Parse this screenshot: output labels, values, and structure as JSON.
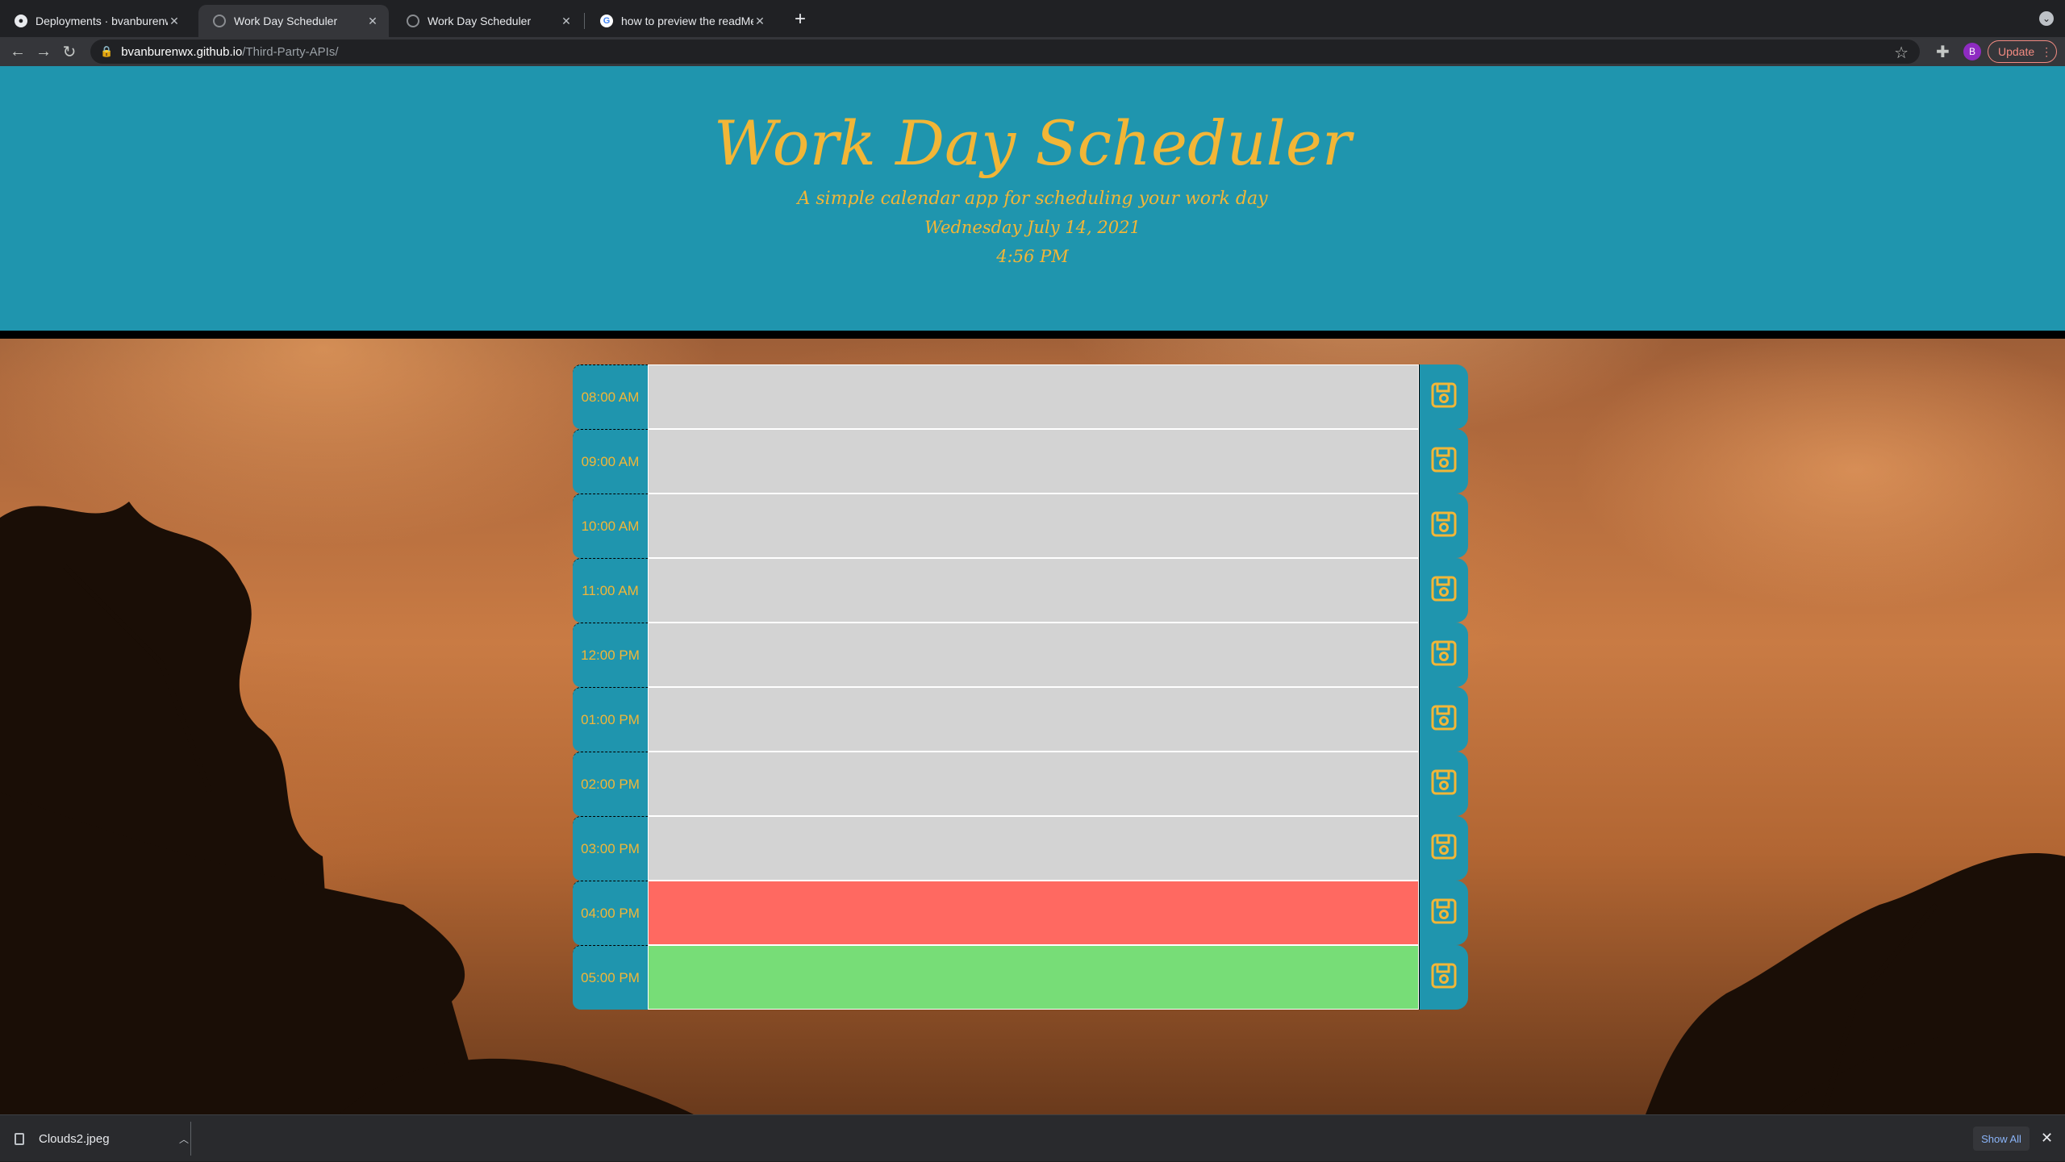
{
  "browser": {
    "tabs": [
      {
        "title": "Deployments · bvanburenwx/Third-Party-APIs",
        "favicon": "github-icon",
        "active": false
      },
      {
        "title": "Work Day Scheduler",
        "favicon": "globe-icon",
        "active": true
      },
      {
        "title": "Work Day Scheduler",
        "favicon": "globe-icon",
        "active": false
      },
      {
        "title": "how to preview the readMe file",
        "favicon": "google-icon",
        "active": false
      }
    ],
    "url_host": "bvanburenwx.github.io",
    "url_path": "/Third-Party-APIs/",
    "profile_initial": "B",
    "update_label": "Update"
  },
  "header": {
    "title": "Work Day Scheduler",
    "subtitle": "A simple calendar app for scheduling your work day",
    "date": "Wednesday July 14, 2021",
    "time": "4:56 PM"
  },
  "scheduler": {
    "rows": [
      {
        "hour": "08:00 AM",
        "status": "past",
        "text": ""
      },
      {
        "hour": "09:00 AM",
        "status": "past",
        "text": ""
      },
      {
        "hour": "10:00 AM",
        "status": "past",
        "text": ""
      },
      {
        "hour": "11:00 AM",
        "status": "past",
        "text": ""
      },
      {
        "hour": "12:00 PM",
        "status": "past",
        "text": ""
      },
      {
        "hour": "01:00 PM",
        "status": "past",
        "text": ""
      },
      {
        "hour": "02:00 PM",
        "status": "past",
        "text": ""
      },
      {
        "hour": "03:00 PM",
        "status": "past",
        "text": ""
      },
      {
        "hour": "04:00 PM",
        "status": "present",
        "text": ""
      },
      {
        "hour": "05:00 PM",
        "status": "future",
        "text": ""
      }
    ]
  },
  "colors": {
    "header_bg": "#1f95ae",
    "accent_gold": "#f2b637",
    "past": "#d3d3d3",
    "present": "#ff6961",
    "future": "#77dd77"
  },
  "downloads": {
    "file_name": "Clouds2.jpeg",
    "show_all_label": "Show All"
  }
}
